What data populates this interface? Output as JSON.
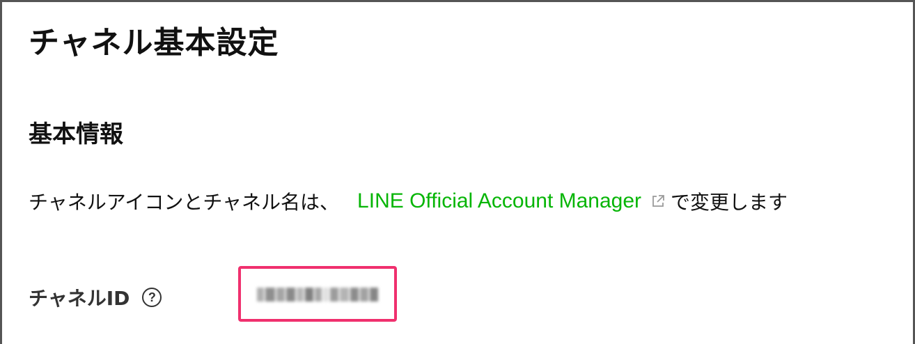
{
  "page": {
    "title": "チャネル基本設定"
  },
  "basic_info": {
    "section_title": "基本情報",
    "description_prefix": "チャネルアイコンとチャネル名は、",
    "link_text": "LINE Official Account Manager",
    "description_suffix": "で変更します"
  },
  "channel_id": {
    "label": "チャネルID",
    "help_symbol": "?",
    "value_state": "blurred"
  },
  "colors": {
    "link": "#06b506",
    "highlight": "#f0306e",
    "border": "#555555"
  },
  "icons": {
    "external_link": "external-link-icon",
    "help": "help-circle-icon"
  }
}
